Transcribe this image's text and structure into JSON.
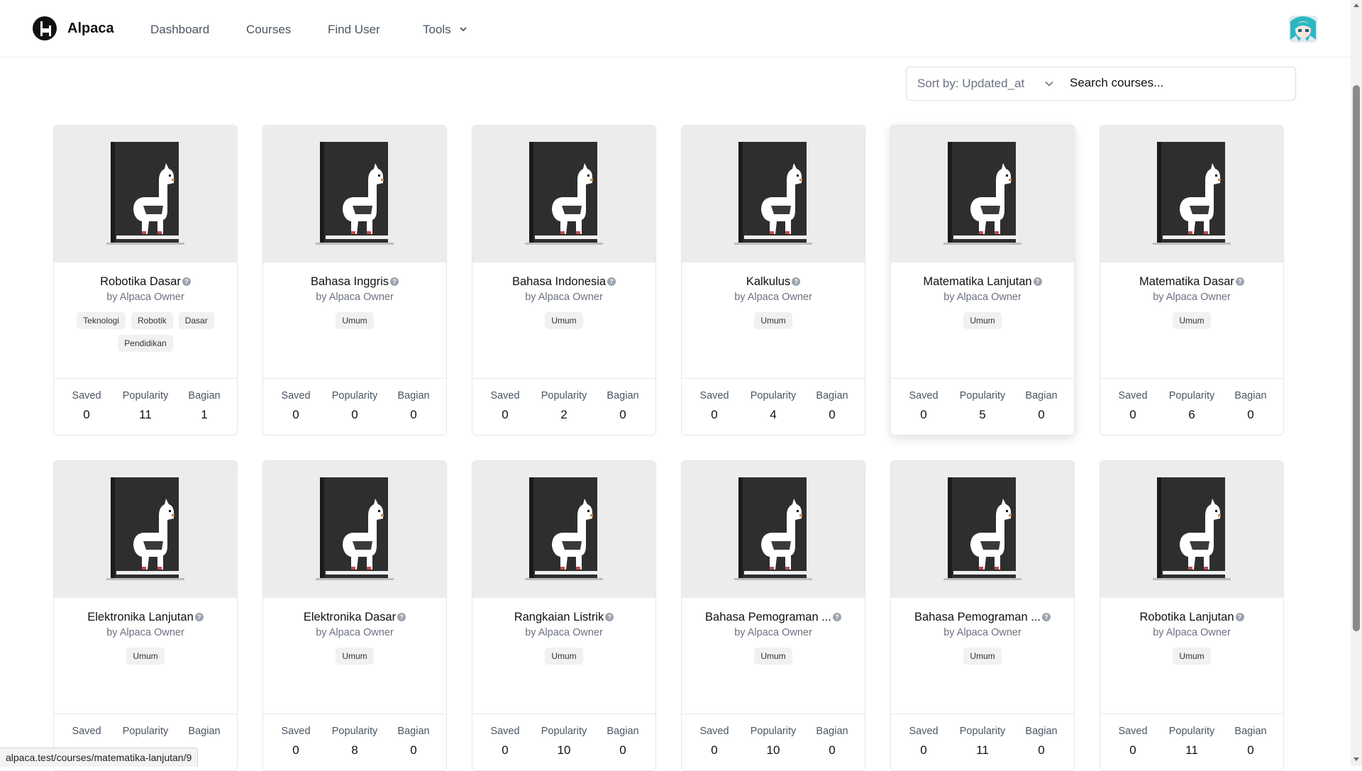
{
  "nav": {
    "brand": "Alpaca",
    "links": [
      "Dashboard",
      "Courses",
      "Find User"
    ],
    "tools_label": "Tools"
  },
  "toolbar": {
    "sort_label": "Sort by: Updated_at",
    "search_placeholder": "Search courses..."
  },
  "stat_labels": [
    "Saved",
    "Popularity",
    "Bagian"
  ],
  "courses": [
    {
      "title": "Robotika Dasar",
      "author": "by Alpaca Owner",
      "tags": [
        "Teknologi",
        "Robotik",
        "Dasar",
        "Pendidikan"
      ],
      "saved": "0",
      "popularity": "11",
      "bagian": "1"
    },
    {
      "title": "Bahasa Inggris",
      "author": "by Alpaca Owner",
      "tags": [
        "Umum"
      ],
      "saved": "0",
      "popularity": "0",
      "bagian": "0"
    },
    {
      "title": "Bahasa Indonesia",
      "author": "by Alpaca Owner",
      "tags": [
        "Umum"
      ],
      "saved": "0",
      "popularity": "2",
      "bagian": "0"
    },
    {
      "title": "Kalkulus",
      "author": "by Alpaca Owner",
      "tags": [
        "Umum"
      ],
      "saved": "0",
      "popularity": "4",
      "bagian": "0"
    },
    {
      "title": "Matematika Lanjutan",
      "author": "by Alpaca Owner",
      "tags": [
        "Umum"
      ],
      "saved": "0",
      "popularity": "5",
      "bagian": "0"
    },
    {
      "title": "Matematika Dasar",
      "author": "by Alpaca Owner",
      "tags": [
        "Umum"
      ],
      "saved": "0",
      "popularity": "6",
      "bagian": "0"
    },
    {
      "title": "Elektronika Lanjutan",
      "author": "by Alpaca Owner",
      "tags": [
        "Umum"
      ],
      "saved": "",
      "popularity": "",
      "bagian": ""
    },
    {
      "title": "Elektronika Dasar",
      "author": "by Alpaca Owner",
      "tags": [
        "Umum"
      ],
      "saved": "0",
      "popularity": "8",
      "bagian": "0"
    },
    {
      "title": "Rangkaian Listrik",
      "author": "by Alpaca Owner",
      "tags": [
        "Umum"
      ],
      "saved": "0",
      "popularity": "10",
      "bagian": "0"
    },
    {
      "title": "Bahasa Pemograman ...",
      "author": "by Alpaca Owner",
      "tags": [
        "Umum"
      ],
      "saved": "0",
      "popularity": "10",
      "bagian": "0"
    },
    {
      "title": "Bahasa Pemograman ...",
      "author": "by Alpaca Owner",
      "tags": [
        "Umum"
      ],
      "saved": "0",
      "popularity": "11",
      "bagian": "0"
    },
    {
      "title": "Robotika Lanjutan",
      "author": "by Alpaca Owner",
      "tags": [
        "Umum"
      ],
      "saved": "0",
      "popularity": "11",
      "bagian": "0"
    }
  ],
  "hovered_card_index": 4,
  "status_url": "alpaca.test/courses/matematika-lanjutan/9"
}
